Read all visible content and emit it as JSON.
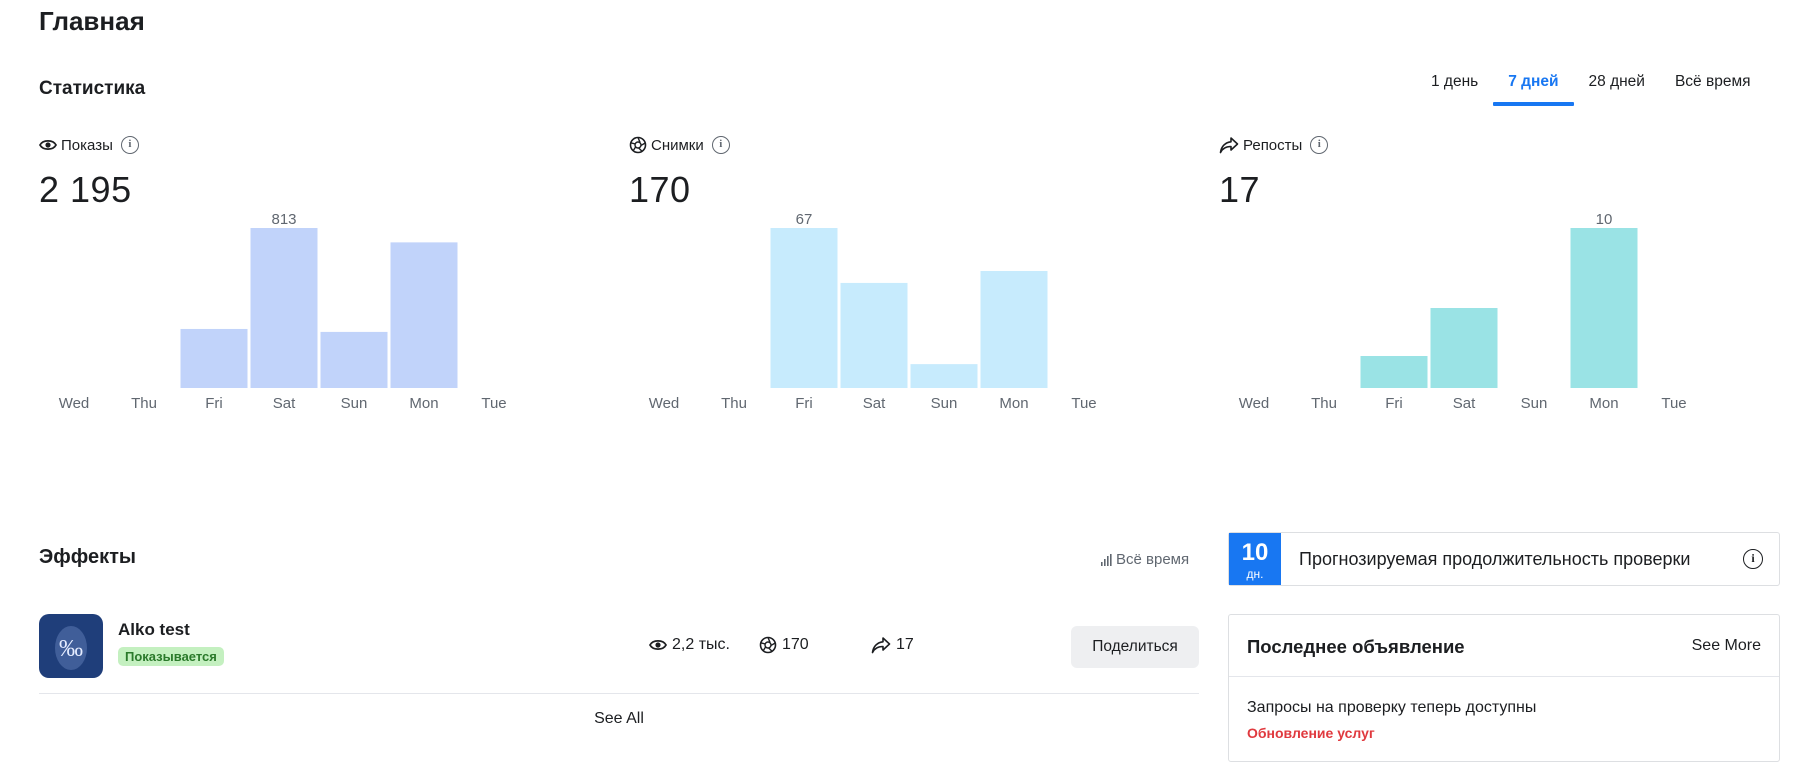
{
  "header": {
    "title": "Главная"
  },
  "stats": {
    "title": "Статистика",
    "ranges": [
      {
        "label": "1 день",
        "active": false
      },
      {
        "label": "7 дней",
        "active": true
      },
      {
        "label": "28 дней",
        "active": false
      },
      {
        "label": "Всё время",
        "active": false
      }
    ],
    "metrics": [
      {
        "id": "impressions",
        "label": "Показы",
        "icon": "eye-icon",
        "value": "2 195",
        "color": "#c1d3fa"
      },
      {
        "id": "captures",
        "label": "Снимки",
        "icon": "camera-shutter-icon",
        "value": "170",
        "color": "#c7ebfd"
      },
      {
        "id": "shares",
        "label": "Репосты",
        "icon": "share-arrow-icon",
        "value": "17",
        "color": "#9ae3e5"
      }
    ],
    "info_glyph": "i"
  },
  "chart_data": [
    {
      "type": "bar",
      "categories": [
        "Wed",
        "Thu",
        "Fri",
        "Sat",
        "Sun",
        "Mon",
        "Tue"
      ],
      "values": [
        0,
        0,
        300,
        813,
        285,
        740,
        0
      ],
      "data_labels": {
        "3": "813"
      },
      "ylim": [
        0,
        813
      ],
      "grid": false
    },
    {
      "type": "bar",
      "categories": [
        "Wed",
        "Thu",
        "Fri",
        "Sat",
        "Sun",
        "Mon",
        "Tue"
      ],
      "values": [
        0,
        0,
        67,
        44,
        10,
        49,
        0
      ],
      "data_labels": {
        "2": "67"
      },
      "ylim": [
        0,
        67
      ],
      "grid": false
    },
    {
      "type": "bar",
      "categories": [
        "Wed",
        "Thu",
        "Fri",
        "Sat",
        "Sun",
        "Mon",
        "Tue"
      ],
      "values": [
        0,
        0,
        2,
        5,
        0,
        10,
        0
      ],
      "data_labels": {
        "5": "10"
      },
      "ylim": [
        0,
        10
      ],
      "grid": false
    }
  ],
  "effects": {
    "title": "Эффекты",
    "range_label": "Всё время",
    "items": [
      {
        "name": "Alko test",
        "status": "Показывается",
        "thumb_text": "‰",
        "impressions": "2,2 тыс.",
        "captures": "170",
        "shares": "17",
        "share_label": "Поделиться"
      }
    ],
    "see_all": "See All"
  },
  "review": {
    "days": "10",
    "unit": "дн.",
    "text": "Прогнозируемая продолжительность проверки",
    "accent": "#1877f2"
  },
  "announcement": {
    "title": "Последнее объявление",
    "see_more": "See More",
    "text": "Запросы на проверку теперь доступны",
    "link": "Обновление услуг",
    "link_color": "#e0393e"
  }
}
